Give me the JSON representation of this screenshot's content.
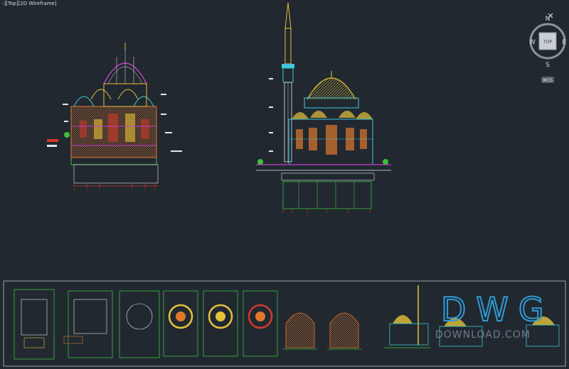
{
  "viewport": {
    "label": "-][Top][2D Wireframe]"
  },
  "viewcube": {
    "face_label": "TOP",
    "north": "N",
    "south": "S",
    "east": "E",
    "west": "W",
    "wcs_label": "WCS"
  },
  "watermark": {
    "main": "DWG",
    "sub": "DOWNLOAD.COM"
  },
  "colors": {
    "background": "#212830",
    "line_yellow": "#e6c23a",
    "line_orange": "#e0772c",
    "line_red": "#d23a2a",
    "line_green": "#3fbf3f",
    "line_cyan": "#3ec7d6",
    "line_magenta": "#c43ec8",
    "line_white": "#e8e8e8",
    "watermark_blue": "#2f9bd6",
    "watermark_red": "#d9362c"
  },
  "icons": [
    "viewcube-icon",
    "close-icon"
  ],
  "thumbnail_count": 13
}
